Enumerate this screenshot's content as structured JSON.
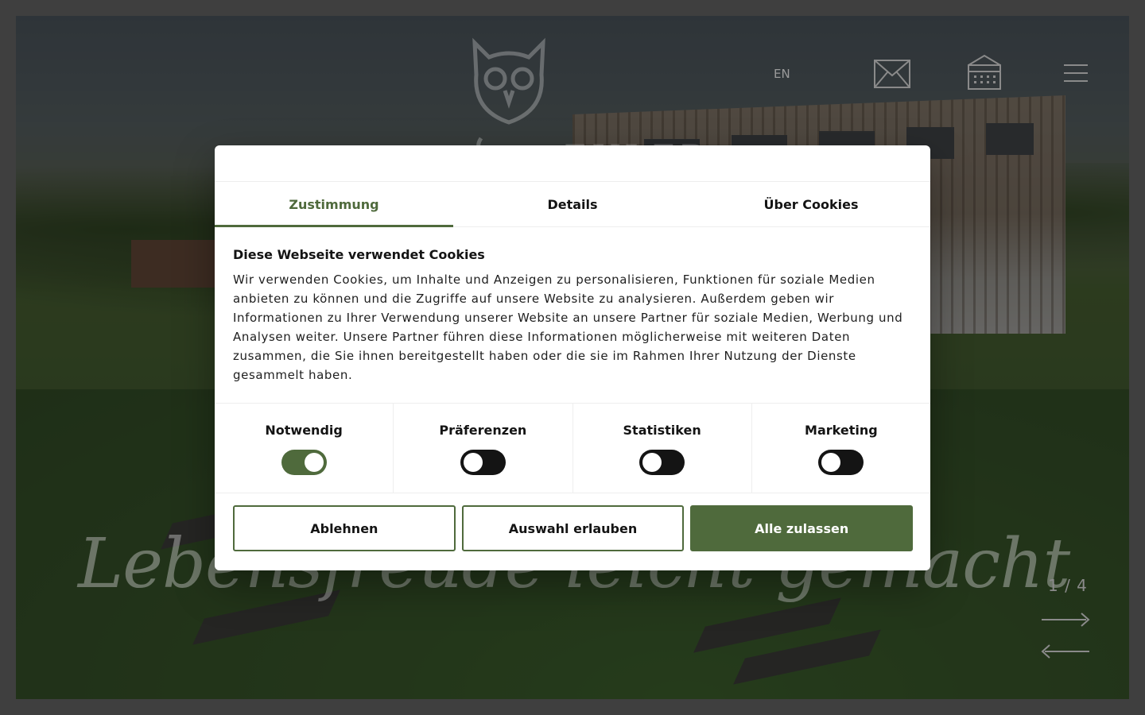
{
  "header": {
    "logo_text": "EULER",
    "language": "EN"
  },
  "hero": {
    "slogan": "Lebensfreude leicht gemacht",
    "slide_counter": "1 / 4"
  },
  "cookie_dialog": {
    "tabs": [
      {
        "label": "Zustimmung",
        "active": true
      },
      {
        "label": "Details",
        "active": false
      },
      {
        "label": "Über Cookies",
        "active": false
      }
    ],
    "heading": "Diese Webseite verwendet Cookies",
    "text": "Wir verwenden Cookies, um Inhalte und Anzeigen zu personalisieren, Funktionen für soziale Medien anbieten zu können und die Zugriffe auf unsere Website zu analysieren. Außerdem geben wir Informationen zu Ihrer Verwendung unserer Website an unsere Partner für soziale Medien, Werbung und Analysen weiter. Unsere Partner führen diese Informationen möglicherweise mit weiteren Daten zusammen, die Sie ihnen bereitgestellt haben oder die sie im Rahmen Ihrer Nutzung der Dienste gesammelt haben.",
    "categories": [
      {
        "label": "Notwendig",
        "enabled": true
      },
      {
        "label": "Präferenzen",
        "enabled": false
      },
      {
        "label": "Statistiken",
        "enabled": false
      },
      {
        "label": "Marketing",
        "enabled": false
      }
    ],
    "buttons": {
      "decline": "Ablehnen",
      "allow_selection": "Auswahl erlauben",
      "allow_all": "Alle zulassen"
    }
  },
  "colors": {
    "accent": "#4f6a3c",
    "toggle_off": "#141414",
    "page_frame": "#3f3f3f"
  }
}
